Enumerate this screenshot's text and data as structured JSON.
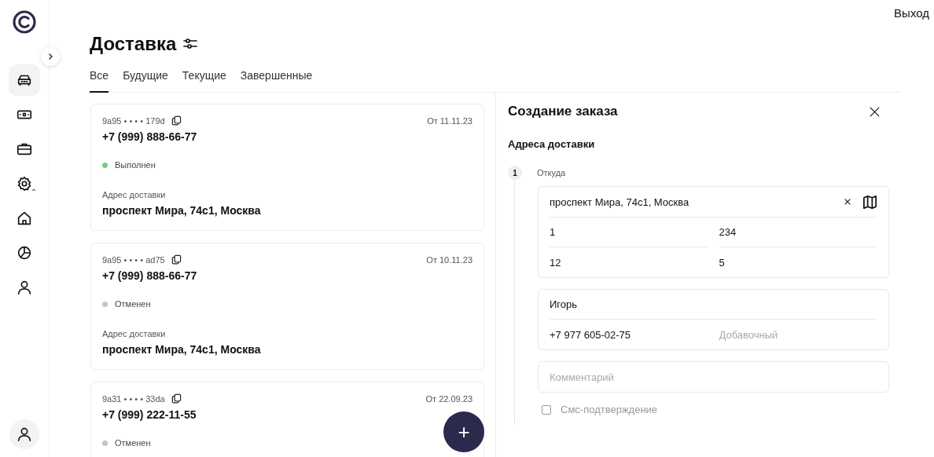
{
  "header": {
    "logout": "Выход"
  },
  "sidebar": {
    "items": [
      {
        "kind": "car",
        "selected": true
      },
      {
        "kind": "cash",
        "selected": false
      },
      {
        "kind": "briefcase",
        "selected": false
      },
      {
        "kind": "gear",
        "selected": false
      },
      {
        "kind": "home",
        "selected": false
      },
      {
        "kind": "pie",
        "selected": false
      },
      {
        "kind": "user",
        "selected": false
      }
    ]
  },
  "page": {
    "title": "Доставка"
  },
  "tabs": [
    {
      "label": "Все",
      "selected": true
    },
    {
      "label": "Будущие",
      "selected": false
    },
    {
      "label": "Текущие",
      "selected": false
    },
    {
      "label": "Завершенные",
      "selected": false
    }
  ],
  "orders": [
    {
      "id": "9a95 • • • • 179d",
      "date": "От 11.11.23",
      "phone": "+7 (999) 888-66-77",
      "status": "Выполнен",
      "color": "#6fd07f",
      "address_label": "Адрес доставки",
      "address": "проспект Мира, 74с1, Москва"
    },
    {
      "id": "9a95 • • • • ad75",
      "date": "От 10.11.23",
      "phone": "+7 (999) 888-66-77",
      "status": "Отменен",
      "color": "#c4c4c4",
      "address_label": "Адрес доставки",
      "address": "проспект Мира, 74с1, Москва"
    },
    {
      "id": "9a31 • • • • 33da",
      "date": "От 22.09.23",
      "phone": "+7 (999) 222-11-55",
      "status": "Отменен",
      "color": "#c4c4c4"
    }
  ],
  "add_button": "+",
  "panel": {
    "title": "Создание заказа",
    "section": "Адреса доставки",
    "step": {
      "number": "1",
      "label": "Откуда"
    },
    "address": "проспект Мира, 74с1, Москва",
    "details": [
      "1",
      "234",
      "12",
      "5"
    ],
    "contact": {
      "name": "Игорь",
      "phone": "+7 977 605-02-75",
      "extension_placeholder": "Добавочный"
    },
    "comment_placeholder": "Комментарий",
    "sms": {
      "label": "Смс-подтверждение",
      "checked": false
    }
  }
}
